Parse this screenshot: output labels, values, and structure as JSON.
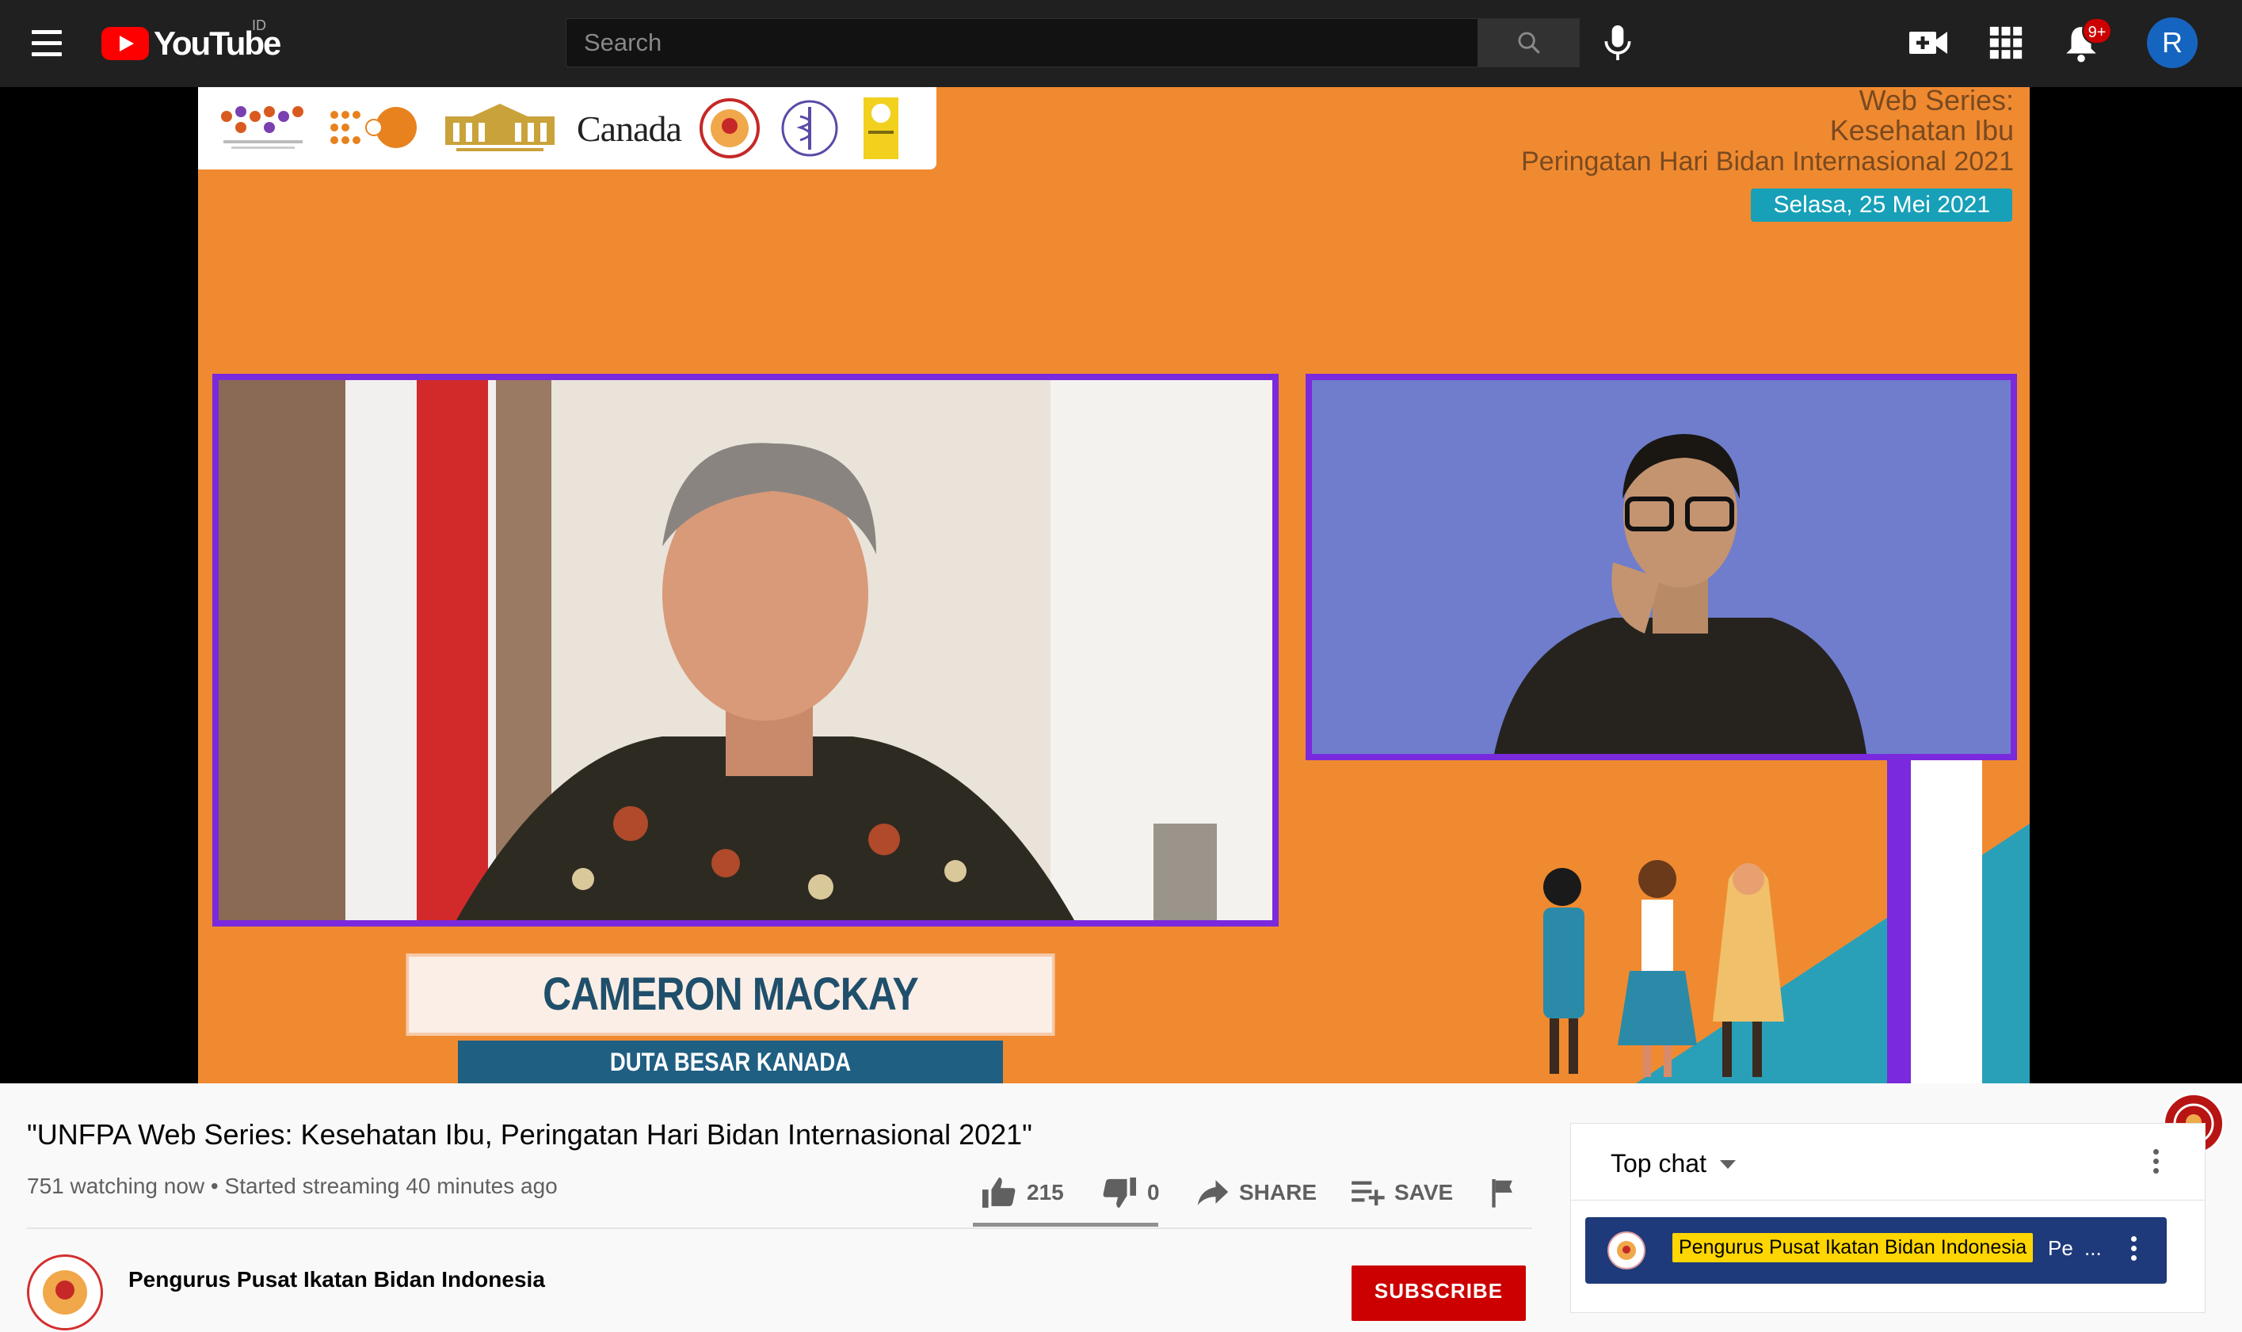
{
  "masthead": {
    "logo_text": "YouTube",
    "region": "ID",
    "search_placeholder": "Search",
    "notification_count": "9+",
    "avatar_initial": "R"
  },
  "video": {
    "header": {
      "line1": "Web Series:",
      "line2": "Kesehatan Ibu",
      "line3": "Peringatan Hari Bidan Internasional 2021",
      "date": "Selasa, 25 Mei 2021"
    },
    "partner_logos": [
      "knowledge-hub-logo",
      "unfpa-logo",
      "kantor-staf-presiden-logo",
      "canada-wordmark",
      "ibi-logo",
      "medical-association-logo",
      "university-logo"
    ],
    "canada_wordmark": "Canada",
    "speaker_name": "CAMERON MACKAY",
    "speaker_title": "DUTA BESAR KANADA"
  },
  "details": {
    "title": "\"UNFPA Web Series: Kesehatan Ibu, Peringatan Hari Bidan Internasional 2021\"",
    "meta": "751 watching now • Started streaming 40 minutes ago",
    "likes": "215",
    "dislikes": "0",
    "share_label": "SHARE",
    "save_label": "SAVE",
    "like_ratio": 1.0
  },
  "channel": {
    "name": "Pengurus Pusat Ikatan Bidan Indonesia",
    "subscribe_label": "SUBSCRIBE"
  },
  "chat": {
    "mode": "Top chat",
    "pinned_author": "Pengurus Pusat Ikatan Bidan Indonesia",
    "pinned_message": "Pe",
    "pinned_ellipsis": "..."
  },
  "colors": {
    "brand_red": "#ff0000",
    "video_bg": "#f08a30",
    "frame_purple": "#7a2adc",
    "pinned_bg": "#1e3a7a",
    "author_highlight": "#ffd600"
  }
}
